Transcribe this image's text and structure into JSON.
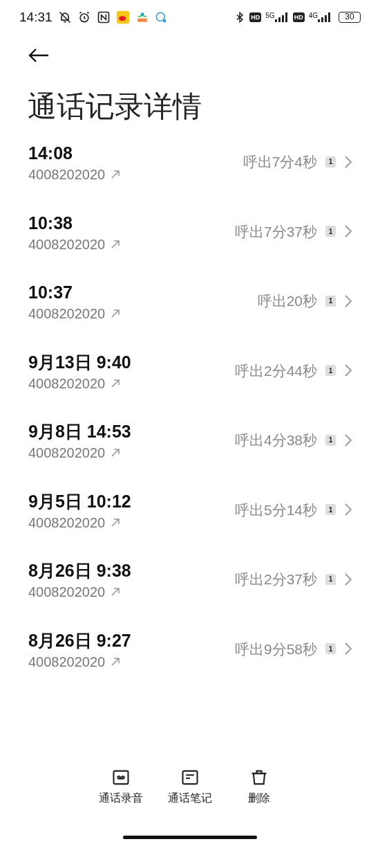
{
  "status_bar": {
    "time": "14:31",
    "hd_1": "HD",
    "network_1": "5G",
    "hd_2": "HD",
    "network_2": "4G",
    "battery": "30"
  },
  "title": "通话记录详情",
  "calls": [
    {
      "time": "14:08",
      "number": "4008202020",
      "summary": "呼出7分4秒",
      "sim": "1"
    },
    {
      "time": "10:38",
      "number": "4008202020",
      "summary": "呼出7分37秒",
      "sim": "1"
    },
    {
      "time": "10:37",
      "number": "4008202020",
      "summary": "呼出20秒",
      "sim": "1"
    },
    {
      "time": "9月13日 9:40",
      "number": "4008202020",
      "summary": "呼出2分44秒",
      "sim": "1"
    },
    {
      "time": "9月8日 14:53",
      "number": "4008202020",
      "summary": "呼出4分38秒",
      "sim": "1"
    },
    {
      "time": "9月5日 10:12",
      "number": "4008202020",
      "summary": "呼出5分14秒",
      "sim": "1"
    },
    {
      "time": "8月26日 9:38",
      "number": "4008202020",
      "summary": "呼出2分37秒",
      "sim": "1"
    },
    {
      "time": "8月26日 9:27",
      "number": "4008202020",
      "summary": "呼出9分58秒",
      "sim": "1"
    }
  ],
  "actions": [
    {
      "kind": "recording",
      "label": "通话录音"
    },
    {
      "kind": "notes",
      "label": "通话笔记"
    },
    {
      "kind": "delete",
      "label": "删除"
    }
  ]
}
